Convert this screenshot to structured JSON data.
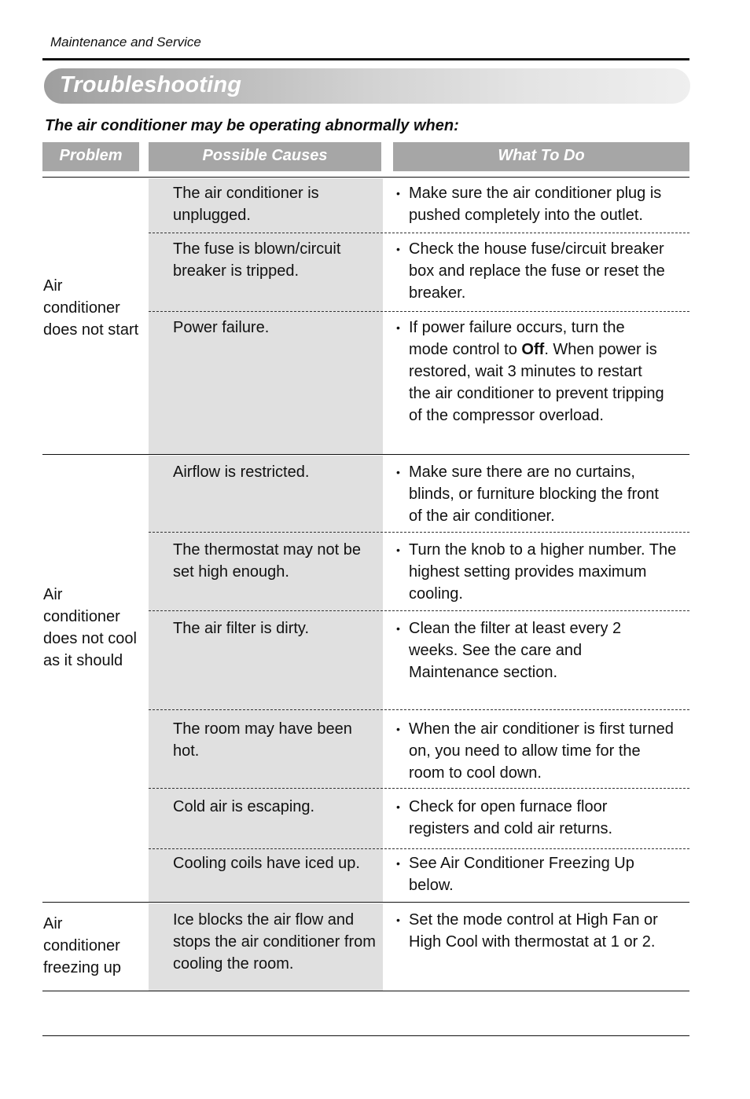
{
  "running_head": "Maintenance and Service",
  "title": "Troubleshooting",
  "intro": "The air conditioner may be operating abnormally when:",
  "columns": {
    "problem": "Problem",
    "causes": "Possible Causes",
    "todo": "What To Do"
  },
  "bullet": "•",
  "groups": [
    {
      "problem": "Air conditioner does not start",
      "rows": [
        {
          "cause": "The air conditioner is unplugged.",
          "todo": "Make sure the air conditioner plug is pushed completely into the outlet."
        },
        {
          "cause": "The fuse is blown/circuit breaker is tripped.",
          "todo": "Check the house fuse/circuit breaker box and replace the fuse or reset the breaker."
        },
        {
          "cause": "Power failure.",
          "todo_pre": "If power failure occurs, turn the mode control to ",
          "todo_bold": "Off",
          "todo_post": ". When power is restored, wait 3 minutes to restart the air conditioner to prevent tripping of the compressor overload."
        }
      ]
    },
    {
      "problem": "Air conditioner does not cool as it should",
      "rows": [
        {
          "cause": "Airflow is restricted.",
          "todo": "Make sure there are no curtains, blinds, or furniture blocking the front of the air conditioner."
        },
        {
          "cause": "The thermostat may not be set high enough.",
          "todo": "Turn the knob to a higher number. The highest setting provides maximum cooling."
        },
        {
          "cause": "The air filter is dirty.",
          "todo": "Clean the filter at least every 2 weeks. See the care and Maintenance section."
        },
        {
          "cause": "The room may have been hot.",
          "todo": "When the air conditioner is first turned on, you need to allow time for the room to cool down."
        },
        {
          "cause": "Cold air is escaping.",
          "todo": "Check for open furnace floor registers and cold air returns."
        },
        {
          "cause": "Cooling coils have iced up.",
          "todo": "See Air Conditioner Freezing Up below."
        }
      ]
    },
    {
      "problem": "Air conditioner freezing up",
      "rows": [
        {
          "cause": "Ice blocks the air flow and stops the air conditioner from cooling the room.",
          "todo": "Set the mode control at High Fan or High Cool with thermostat at 1 or 2."
        }
      ]
    }
  ]
}
